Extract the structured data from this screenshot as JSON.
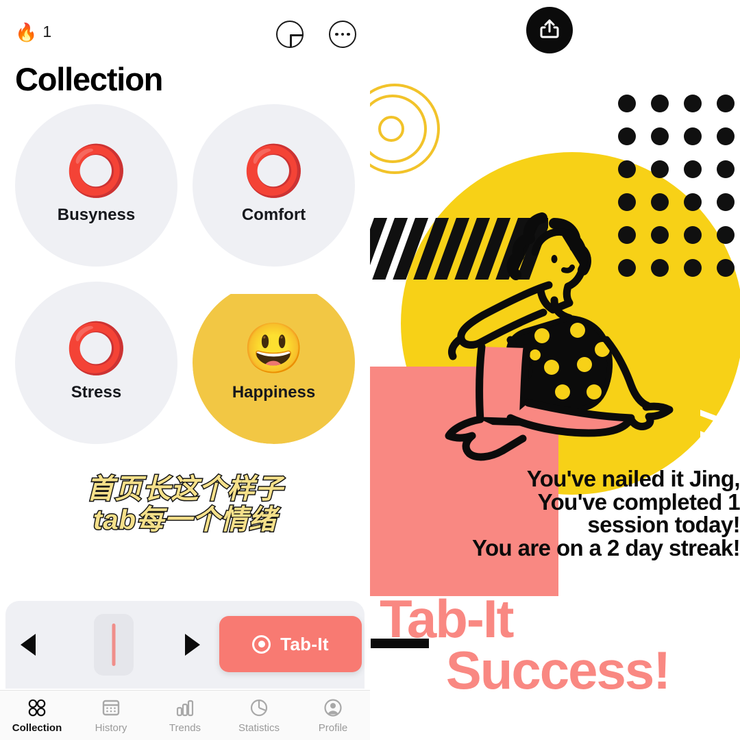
{
  "app": {
    "header": {
      "flame_icon": "flame-icon",
      "streak_count": "1",
      "add_icon": "plus-icon",
      "more_icon": "ellipsis-icon"
    },
    "page_title": "Collection",
    "cards": [
      {
        "label": "Busyness",
        "emoji": "⭕",
        "emoji_name": "red-circle-emoji",
        "selected": false
      },
      {
        "label": "Comfort",
        "emoji": "⭕",
        "emoji_name": "red-circle-emoji",
        "selected": false
      },
      {
        "label": "Stress",
        "emoji": "⭕",
        "emoji_name": "red-circle-emoji",
        "selected": false
      },
      {
        "label": "Happiness",
        "emoji": "😃",
        "emoji_name": "grinning-face-emoji",
        "selected": true
      }
    ],
    "annotation": {
      "line1": "首页长这个样子",
      "line2": "tab每一个情绪"
    },
    "dock": {
      "prev_icon": "triangle-left-icon",
      "next_icon": "triangle-right-icon",
      "slider_name": "intensity-slider",
      "tabit_label": "Tab-It",
      "tabit_icon": "record-icon"
    },
    "tabbar": [
      {
        "label": "Collection",
        "icon": "four-circles-icon",
        "active": true
      },
      {
        "label": "History",
        "icon": "calendar-icon",
        "active": false
      },
      {
        "label": "Trends",
        "icon": "bar-chart-icon",
        "active": false
      },
      {
        "label": "Statistics",
        "icon": "pie-chart-icon",
        "active": false
      },
      {
        "label": "Profile",
        "icon": "person-circle-icon",
        "active": false
      }
    ]
  },
  "share_card": {
    "share_icon": "share-upload-icon",
    "illustration_name": "seated-woman-illustration",
    "message": {
      "line1": "You've nailed it Jing,",
      "line2": "You've completed 1",
      "line3": "session today!",
      "line4": "You are on a 2 day streak!"
    },
    "title": {
      "line1": "Tab-It",
      "line2": "Success!"
    }
  },
  "colors": {
    "coral": "#f98882",
    "yellow": "#f7d117",
    "card_yellow": "#f2c744",
    "card_gray": "#eff0f4",
    "black": "#0b0b0b",
    "annotation_fill": "#f5e08a"
  }
}
